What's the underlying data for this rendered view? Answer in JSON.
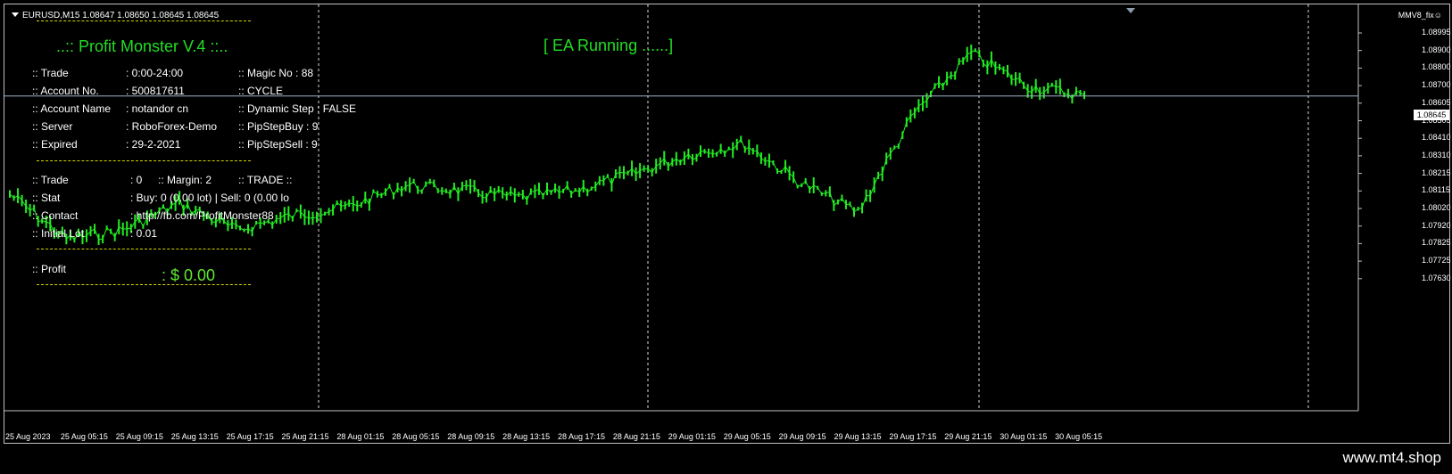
{
  "symbol_line": "EURUSD,M15  1.08647 1.08650 1.08645 1.08645",
  "indicator_tag": "MMV8_fix☺",
  "current_price": "1.08645",
  "panel": {
    "title": "..:: Profit Monster V.4 ::..",
    "status": "[ EA Running ......]",
    "rows_left": [
      {
        "label": ":: Trade",
        "value": ": 0:00-24:00"
      },
      {
        "label": ":: Account No.",
        "value": ": 500817611"
      },
      {
        "label": ":: Account Name",
        "value": ": notandor cn"
      },
      {
        "label": ":: Server",
        "value": ": RoboForex-Demo"
      },
      {
        "label": ":: Expired",
        "value": ": 29-2-2021"
      }
    ],
    "rows_right": [
      ":: Magic No :  88",
      ":: CYCLE",
      ":: Dynamic Step : FALSE",
      ":: PipStepBuy : 9",
      ":: PipStepSell : 9"
    ],
    "trade_label": ":: Trade",
    "trade_value": ": 0",
    "margin_text": ":: Margin: 2",
    "trade_mode": ":: TRADE ::",
    "stat_label": ":: Stat",
    "stat_value": ": Buy: 0 (0.00 lot) | Sell: 0 (0.00 lo",
    "contact_label": ":: Contact",
    "contact_value": ": http://fb.com/ProfitMonster88",
    "lot_label": ":: Initial Lot",
    "lot_value": ": 0.01",
    "profit_label": ":: Profit",
    "profit_value": ": $ 0.00"
  },
  "y_axis": [
    "1.08995",
    "1.08900",
    "1.08800",
    "1.08700",
    "1.08605",
    "1.08505",
    "1.08410",
    "1.08310",
    "1.08215",
    "1.08115",
    "1.08020",
    "1.07920",
    "1.07825",
    "1.07725",
    "1.07630"
  ],
  "x_axis": [
    "25 Aug 2023",
    "25 Aug 05:15",
    "25 Aug 09:15",
    "25 Aug 13:15",
    "25 Aug 17:15",
    "25 Aug 21:15",
    "28 Aug 01:15",
    "28 Aug 05:15",
    "28 Aug 09:15",
    "28 Aug 13:15",
    "28 Aug 17:15",
    "28 Aug 21:15",
    "29 Aug 01:15",
    "29 Aug 05:15",
    "29 Aug 09:15",
    "29 Aug 13:15",
    "29 Aug 17:15",
    "29 Aug 21:15",
    "30 Aug 01:15",
    "30 Aug 05:15"
  ],
  "watermark": "www.mt4.shop",
  "colors": {
    "bars": "#22ee22",
    "background": "#000000",
    "price_line": "#9fb4c8",
    "separator": "#d6d600",
    "panel_text": "#ffffff",
    "title": "#22dd22"
  },
  "chart_data": {
    "type": "line",
    "title": "EURUSD,M15",
    "xlabel": "",
    "ylabel": "",
    "ylim": [
      1.0763,
      1.09
    ],
    "x": [
      "25 Aug 2023",
      "25 Aug 05:15",
      "25 Aug 09:15",
      "25 Aug 13:15",
      "25 Aug 17:15",
      "25 Aug 21:15",
      "28 Aug 01:15",
      "28 Aug 05:15",
      "28 Aug 09:15",
      "28 Aug 13:15",
      "28 Aug 17:15",
      "28 Aug 21:15",
      "29 Aug 01:15",
      "29 Aug 05:15",
      "29 Aug 09:15",
      "29 Aug 13:15",
      "29 Aug 17:15",
      "29 Aug 21:15",
      "30 Aug 01:15",
      "30 Aug 05:15"
    ],
    "series": [
      {
        "values": [
          1.081,
          1.0785,
          1.079,
          1.0805,
          1.079,
          1.0798,
          1.0803,
          1.0815,
          1.0812,
          1.0808,
          1.0812,
          1.0821,
          1.0832,
          1.0838,
          1.0816,
          1.08,
          1.0855,
          1.0888,
          1.087,
          1.0865
        ]
      }
    ]
  }
}
